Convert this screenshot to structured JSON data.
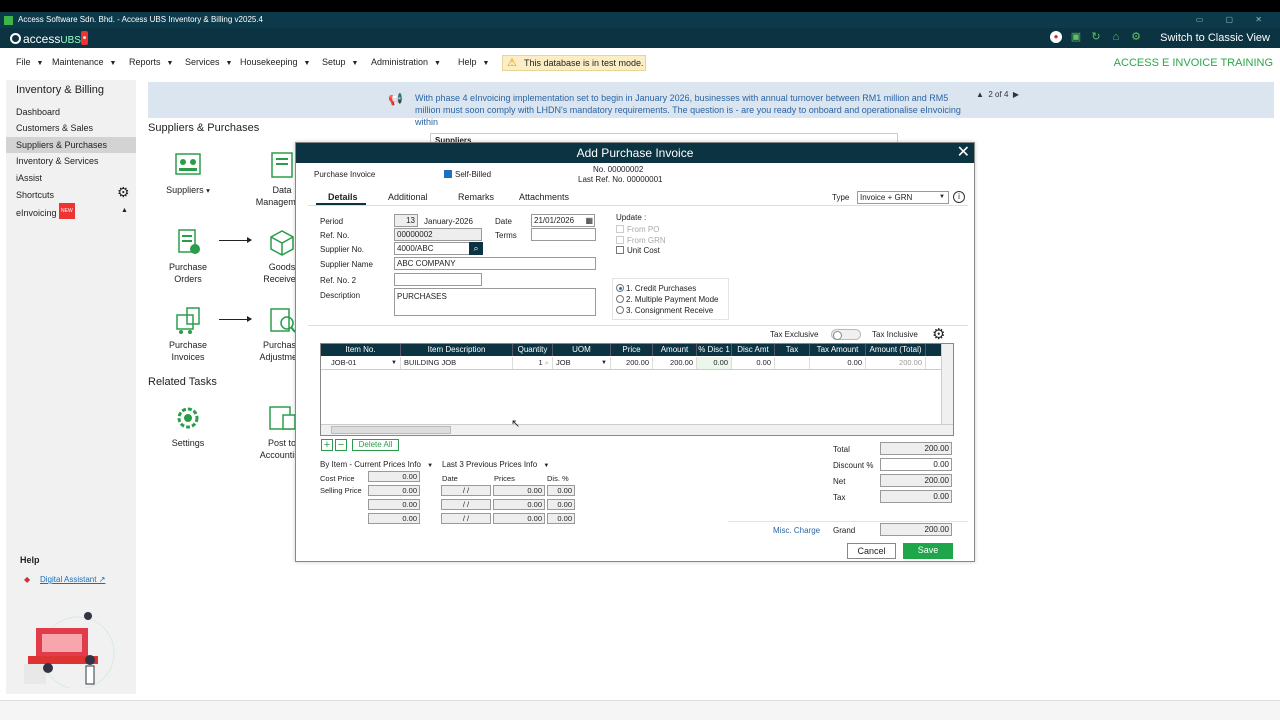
{
  "window": {
    "title": "Access Software Sdn. Bhd. - Access UBS Inventory & Billing v2025.4",
    "brand": "access",
    "brand_sub": "UBS",
    "switch_label": "Switch to Classic View",
    "test_mode": "This database is in test mode.",
    "training_label": "ACCESS  E INVOICE TRAINING"
  },
  "menu": [
    "File",
    "Maintenance",
    "Reports",
    "Services",
    "Housekeeping",
    "Setup",
    "Administration",
    "Help"
  ],
  "sidebar": {
    "title": "Inventory & Billing",
    "items": [
      "Dashboard",
      "Customers & Sales",
      "Suppliers & Purchases",
      "Inventory & Services",
      "iAssist",
      "Shortcuts",
      "eInvoicing"
    ],
    "new_badge": "NEW",
    "help_title": "Help",
    "help_link": "Digital Assistant"
  },
  "banner": {
    "message": "With phase 4 eInvoicing implementation set to begin in January 2026, businesses with annual turnover between RM1 million and RM5 million must soon comply with LHDN's mandatory requirements. The question is - are you ready to onboard and operationalise eInvoicing within",
    "pager": "2 of 4"
  },
  "page": {
    "section_title": "Suppliers & Purchases",
    "related_title": "Related Tasks",
    "bg_supplier": "Suppliers",
    "tiles": {
      "suppliers": "Suppliers",
      "data_mgmt": "Data Management",
      "purchase_orders": "Purchase Orders",
      "goods_received": "Goods Received",
      "purchase_invoices": "Purchase Invoices",
      "purchase_adjustment": "Purchase Adjustment",
      "settings": "Settings",
      "post_to_accounting": "Post to Accounting"
    }
  },
  "dialog": {
    "title": "Add Purchase Invoice",
    "doc_type": "Purchase Invoice",
    "self_billed": "Self-Billed",
    "no_label": "No. 00000002",
    "last_ref": "Last Ref. No. 00000001",
    "tabs": [
      "Details",
      "Additional",
      "Remarks",
      "Attachments"
    ],
    "type_label": "Type",
    "type_value": "Invoice + GRN",
    "period_label": "Period",
    "period_no": "13",
    "period_month": "January-2026",
    "date_label": "Date",
    "date_value": "21/01/2026",
    "terms_label": "Terms",
    "refno_label": "Ref. No.",
    "refno_value": "00000002",
    "supplier_no_label": "Supplier No.",
    "supplier_no_value": "4000/ABC",
    "supplier_name_label": "Supplier Name",
    "supplier_name_value": "ABC COMPANY",
    "refno2_label": "Ref. No. 2",
    "desc_label": "Description",
    "desc_value": "PURCHASES",
    "update_label": "Update :",
    "update_opts": [
      "From PO",
      "From GRN",
      "Unit Cost"
    ],
    "radio_opts": [
      "1. Credit Purchases",
      "2. Multiple Payment Mode",
      "3. Consignment Receive"
    ],
    "tax_exclusive": "Tax Exclusive",
    "tax_inclusive": "Tax Inclusive",
    "grid_headers": [
      "Item No.",
      "Item Description",
      "Quantity",
      "UOM",
      "Price",
      "Amount",
      "% Disc 1",
      "Disc Amt",
      "Tax",
      "Tax Amount",
      "Amount (Total)"
    ],
    "grid_row": [
      "JOB-01",
      "BUILDING JOB",
      "1",
      "JOB",
      "200.00",
      "200.00",
      "0.00",
      "0.00",
      "",
      "0.00",
      "200.00"
    ],
    "delete_all": "Delete All",
    "by_item": "By Item - Current Prices Info",
    "last3": "Last 3 Previous Prices Info",
    "cost_price_label": "Cost Price",
    "selling_price_label": "Selling Price",
    "price_vals": [
      "0.00",
      "0.00",
      "0.00",
      "0.00"
    ],
    "prev_headers": [
      "Date",
      "Prices",
      "Dis. %"
    ],
    "prev_date": "/ /",
    "prev_val": "0.00",
    "total_label": "Total",
    "total_value": "200.00",
    "discount_label": "Discount %",
    "discount_value": "0.00",
    "net_label": "Net",
    "net_value": "200.00",
    "tax_label": "Tax",
    "tax_value": "0.00",
    "misc_charge": "Misc. Charge",
    "grand_label": "Grand",
    "grand_value": "200.00",
    "cancel": "Cancel",
    "save": "Save"
  },
  "colors": {
    "navy": "#0b3342",
    "green": "#1fa64b",
    "banner": "#dbe5ef"
  }
}
